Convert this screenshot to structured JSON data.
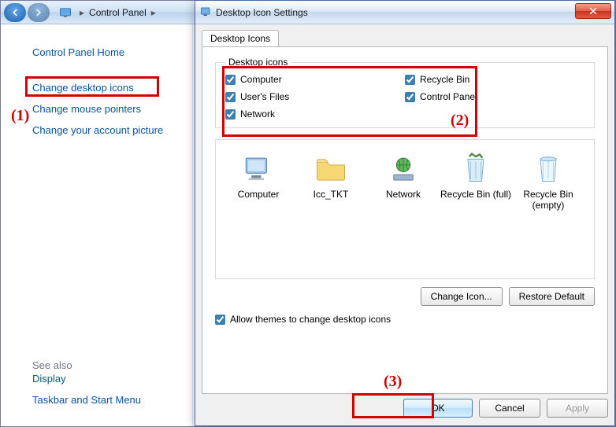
{
  "breadcrumb": {
    "label": "Control Panel"
  },
  "sidebar": {
    "home": "Control Panel Home",
    "links": [
      "Change desktop icons",
      "Change mouse pointers",
      "Change your account picture"
    ],
    "see_also_label": "See also",
    "see_also": [
      "Display",
      "Taskbar and Start Menu"
    ]
  },
  "dialog": {
    "title": "Desktop Icon Settings",
    "tab": "Desktop Icons",
    "group_title": "Desktop icons",
    "checks": {
      "computer": "Computer",
      "users_files": "User's Files",
      "network": "Network",
      "recycle_bin": "Recycle Bin",
      "control_panel": "Control Panel"
    },
    "preview": [
      "Computer",
      "Icc_TKT",
      "Network",
      "Recycle Bin (full)",
      "Recycle Bin (empty)"
    ],
    "change_icon": "Change Icon...",
    "restore_default": "Restore Default",
    "allow_themes": "Allow themes to change desktop icons",
    "ok": "OK",
    "cancel": "Cancel",
    "apply": "Apply"
  },
  "annotations": {
    "one": "(1)",
    "two": "(2)",
    "three": "(3)"
  }
}
